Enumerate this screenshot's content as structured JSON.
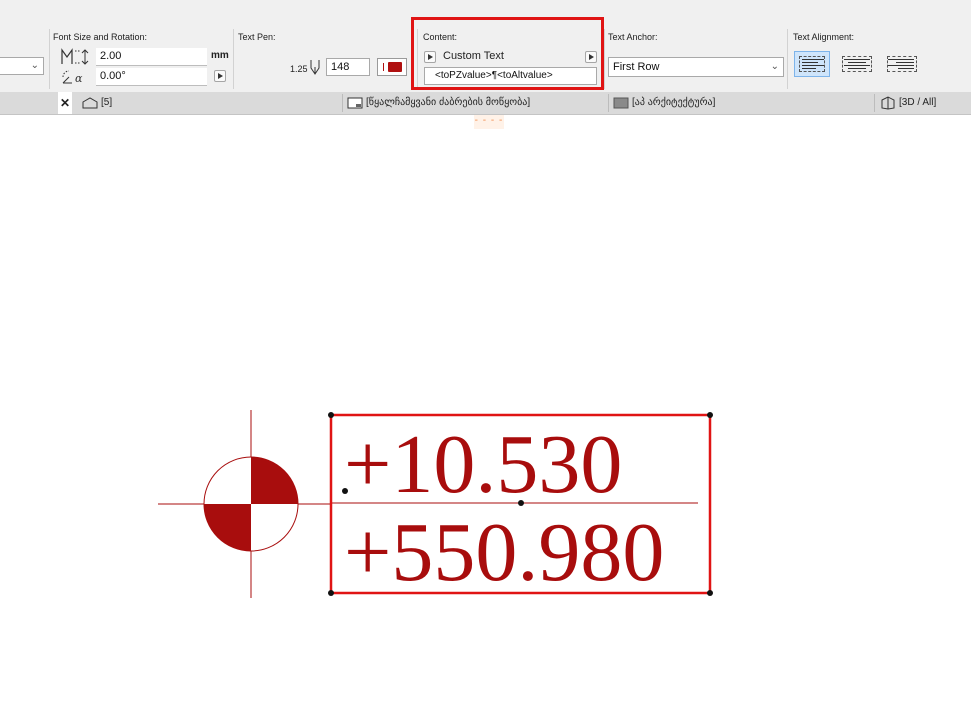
{
  "infobox": {
    "font_size": {
      "label": "Font Size and Rotation:",
      "size_value": "2.00",
      "size_unit": "mm",
      "rotation_value": "0.00°"
    },
    "text_pen": {
      "label": "Text Pen:",
      "pen_weight": "1.25",
      "pen_number": "148",
      "pen_color": "#b01010"
    },
    "content": {
      "label": "Content:",
      "mode": "Custom Text",
      "expression": "<toPZvalue>¶<toAltvalue>"
    },
    "text_anchor": {
      "label": "Text Anchor:",
      "value": "First Row"
    },
    "text_alignment": {
      "label": "Text Alignment:"
    }
  },
  "tabs": [
    {
      "label": "[5]"
    },
    {
      "label": "[წყალჩამყვანი ძაბრების მოწყობა]"
    },
    {
      "label": "[აპ არქიტექტურა]"
    },
    {
      "label": "[3D / All]"
    }
  ],
  "canvas": {
    "dash_marker": "- - - -",
    "label_line1": "+10.530",
    "label_line2": "+550.980",
    "element_color": "#a80d0d",
    "selection_color": "#e01414"
  }
}
